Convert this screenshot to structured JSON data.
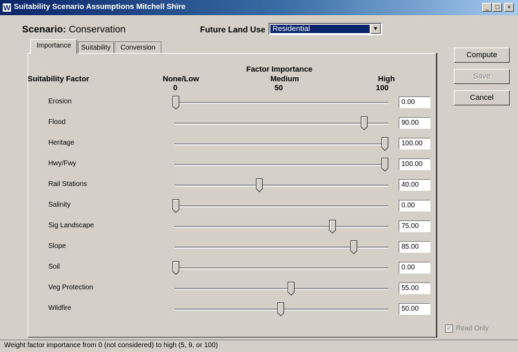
{
  "window": {
    "title": "Suitability Scenario Assumptions   Mitchell Shire",
    "icon_letter": "W"
  },
  "scenario": {
    "label": "Scenario:",
    "name": "Conservation"
  },
  "future_land_use": {
    "label": "Future Land Use",
    "selected": "Residential"
  },
  "tabs": [
    {
      "label": "Importance"
    },
    {
      "label": "Suitability"
    },
    {
      "label": "Conversion"
    }
  ],
  "headers": {
    "suitability_factor": "Suitability Factor",
    "factor_importance": "Factor Importance",
    "none_low": "None/Low",
    "medium": "Medium",
    "high": "High",
    "tick_0": "0",
    "tick_50": "50",
    "tick_100": "100"
  },
  "factors": [
    {
      "label": "Erosion",
      "value": 0,
      "display": "0.00"
    },
    {
      "label": "Flood",
      "value": 90,
      "display": "90.00"
    },
    {
      "label": "Heritage",
      "value": 100,
      "display": "100.00"
    },
    {
      "label": "Hwy/Fwy",
      "value": 100,
      "display": "100.00"
    },
    {
      "label": "Rail Stations",
      "value": 40,
      "display": "40.00"
    },
    {
      "label": "Salinity",
      "value": 0,
      "display": "0.00"
    },
    {
      "label": "Sig Landscape",
      "value": 75,
      "display": "75.00"
    },
    {
      "label": "Slope",
      "value": 85,
      "display": "85.00"
    },
    {
      "label": "Soil",
      "value": 0,
      "display": "0.00"
    },
    {
      "label": "Veg Protection",
      "value": 55,
      "display": "55.00"
    },
    {
      "label": "Wildfire",
      "value": 50,
      "display": "50.00"
    }
  ],
  "buttons": {
    "compute": "Compute",
    "save": "Save",
    "cancel": "Cancel"
  },
  "read_only": {
    "label": "Read Only",
    "checked": true
  },
  "status": "Weight factor importance from 0 (not considered) to high (5, 9, or 100)"
}
